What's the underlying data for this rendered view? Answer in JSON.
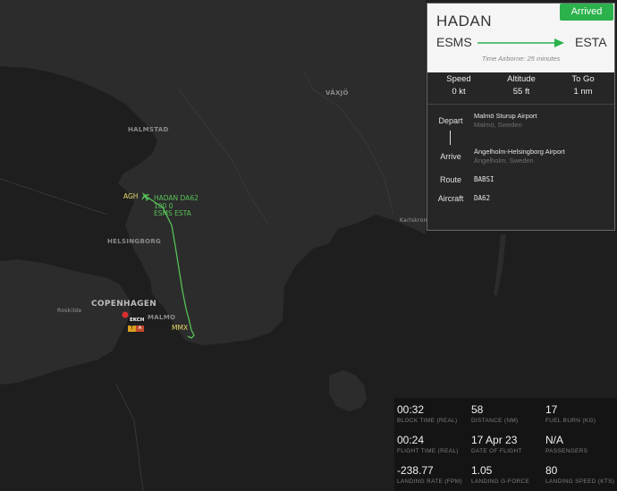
{
  "map": {
    "cities": {
      "halmstad": "HALMSTAD",
      "vaxjo": "VÄXJÖ",
      "karlskrona": "Karlskrona",
      "helsingborg": "HELSINGBORG",
      "copenhagen": "COPENHAGEN",
      "malmo": "MALMO",
      "roskilde": "Roskilde"
    },
    "airports": {
      "agh": "AGH",
      "mmx": "MMX",
      "ekch": "EKCH"
    },
    "ekch_badges": [
      "T",
      "A"
    ],
    "flight_label": [
      "HADAN DA62",
      "100 0",
      "ESMS ESTA"
    ],
    "colors": {
      "route": "#57c157",
      "airport": "#e6d96a",
      "water": "#1e1e1e",
      "land": "#2c2c2c"
    }
  },
  "panel": {
    "callsign": "HADAN",
    "status": "Arrived",
    "departure_code": "ESMS",
    "arrival_code": "ESTA",
    "time_airborne": "Time Airborne: 25 minutes",
    "stats": [
      {
        "label": "Speed",
        "value": "0 kt"
      },
      {
        "label": "Altitude",
        "value": "55 ft"
      },
      {
        "label": "To Go",
        "value": "1 nm"
      }
    ],
    "depart_label": "Depart",
    "depart_name": "Malmö Sturup Airport",
    "depart_city": "Malmö, Sweden",
    "arrive_label": "Arrive",
    "arrive_name": "Ängelholm-Helsingborg Airport",
    "arrive_city": "Ängelholm, Sweden",
    "route_label": "Route",
    "route_value": "BABSI",
    "aircraft_label": "Aircraft",
    "aircraft_value": "DA62",
    "colors": {
      "status": "#2bb24c",
      "arrow": "#2bb24c"
    }
  },
  "stats": [
    {
      "value": "00:32",
      "label": "BLOCK TIME (REAL)"
    },
    {
      "value": "58",
      "label": "DISTANCE (NM)"
    },
    {
      "value": "17",
      "label": "FUEL BURN (KG)"
    },
    {
      "value": "00:24",
      "label": "FLIGHT TIME (REAL)"
    },
    {
      "value": "17 Apr 23",
      "label": "DATE OF FLIGHT"
    },
    {
      "value": "N/A",
      "label": "PASSENGERS"
    },
    {
      "value": "-238.77",
      "label": "LANDING RATE (FPM)"
    },
    {
      "value": "1.05",
      "label": "LANDING G-FORCE"
    },
    {
      "value": "80",
      "label": "LANDING SPEED (KTS)"
    }
  ]
}
